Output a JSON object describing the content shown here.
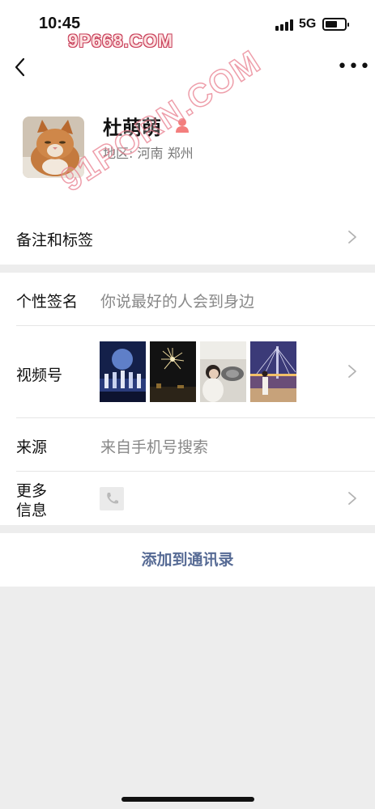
{
  "status_bar": {
    "time": "10:45",
    "network": "5G"
  },
  "watermarks": {
    "top": "9P668.COM",
    "diagonal": "91PORN.COM"
  },
  "nav": {
    "more_label": "•••"
  },
  "profile": {
    "name": "杜萌萌",
    "region": "地区: 河南 郑州"
  },
  "remark_row": {
    "label": "备注和标签"
  },
  "info": {
    "signature": {
      "label": "个性签名",
      "value": "你说最好的人会到身边"
    },
    "channels": {
      "label": "视频号",
      "thumbnails": [
        "stage-performance",
        "fireworks",
        "car-selfie",
        "bridge-night"
      ]
    },
    "source": {
      "label": "来源",
      "value": "来自手机号搜索"
    },
    "more": {
      "label_line1": "更多",
      "label_line2": "信息"
    }
  },
  "add_button": {
    "label": "添加到通讯录"
  },
  "colors": {
    "link": "#576b95",
    "background": "#ededed",
    "gender_female": "#f37e7d"
  }
}
